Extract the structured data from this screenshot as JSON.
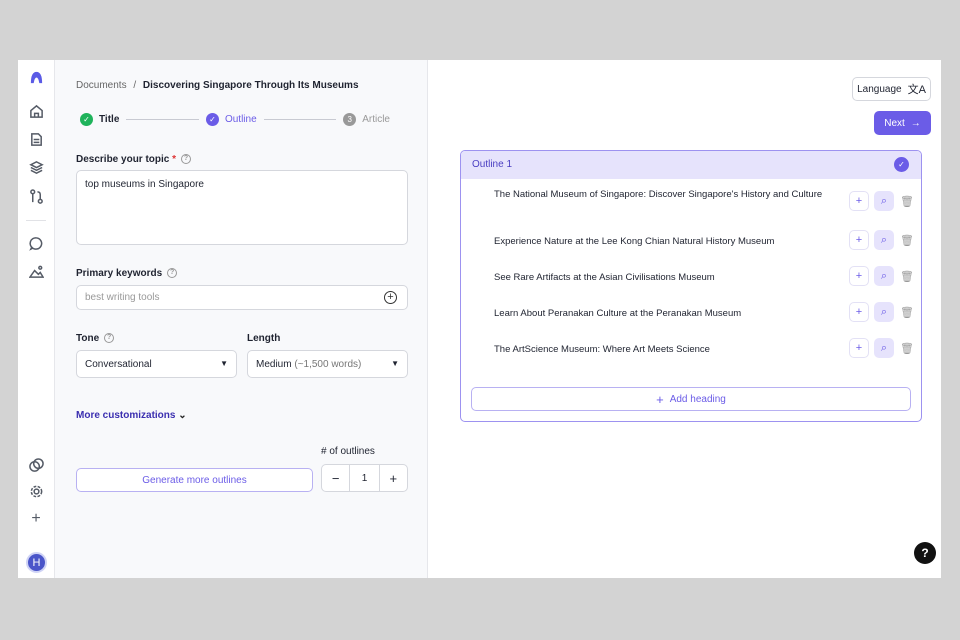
{
  "breadcrumb": {
    "root": "Documents",
    "separator": "/",
    "current": "Discovering Singapore Through Its Museums"
  },
  "steps": [
    {
      "label": "Title",
      "state": "done"
    },
    {
      "label": "Outline",
      "state": "active"
    },
    {
      "label": "Article",
      "number": "3",
      "state": "pending"
    }
  ],
  "topic": {
    "label": "Describe your topic",
    "required": "*",
    "value": "top museums in Singapore"
  },
  "keywords": {
    "label": "Primary keywords",
    "placeholder": "best writing tools"
  },
  "tone": {
    "label": "Tone",
    "value": "Conversational"
  },
  "length": {
    "label": "Length",
    "value": "Medium",
    "detail": "(~1,500 words)"
  },
  "more_customizations": "More customizations",
  "outlines_count": {
    "label": "# of outlines",
    "value": "1",
    "minus": "−",
    "plus": "+"
  },
  "generate_button": "Generate more outlines",
  "language_button": "Language",
  "next_button": "Next",
  "outline": {
    "title": "Outline 1",
    "headings": [
      "The National Museum of Singapore: Discover Singapore's History and Culture",
      "Experience Nature at the Lee Kong Chian Natural History Museum",
      "See Rare Artifacts at the Asian Civilisations Museum",
      "Learn About Peranakan Culture at the Peranakan Museum",
      "The ArtScience Museum: Where Art Meets Science"
    ],
    "add_heading": "Add heading"
  },
  "user_initial": "H",
  "help_button": "?",
  "colors": {
    "accent": "#6b5ce7",
    "success": "#1fb35b"
  }
}
